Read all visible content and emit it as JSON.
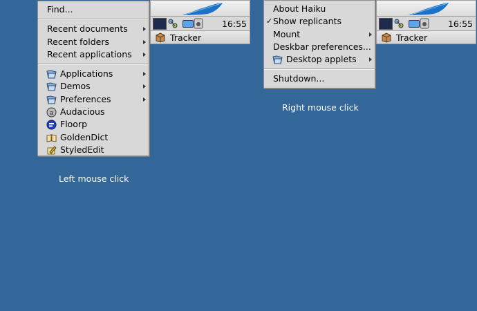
{
  "left_menu": {
    "items": [
      {
        "label": "Find...",
        "icon": "",
        "submenu": false
      },
      {
        "sep": true
      },
      {
        "label": "Recent documents",
        "icon": "",
        "submenu": true
      },
      {
        "label": "Recent folders",
        "icon": "",
        "submenu": true
      },
      {
        "label": "Recent applications",
        "icon": "",
        "submenu": true
      },
      {
        "sep": true
      },
      {
        "label": "Applications",
        "icon": "folder-icon",
        "submenu": true
      },
      {
        "label": "Demos",
        "icon": "folder-icon",
        "submenu": true
      },
      {
        "label": "Preferences",
        "icon": "folder-icon",
        "submenu": true
      },
      {
        "label": "Audacious",
        "icon": "audacious-icon",
        "submenu": false
      },
      {
        "label": "Floorp",
        "icon": "floorp-icon",
        "submenu": false
      },
      {
        "label": "GoldenDict",
        "icon": "book-icon",
        "submenu": false
      },
      {
        "label": "StyledEdit",
        "icon": "pencil-icon",
        "submenu": false
      }
    ]
  },
  "right_menu": {
    "items": [
      {
        "label": "About Haiku",
        "icon": "",
        "submenu": false,
        "checked": false
      },
      {
        "label": "Show replicants",
        "icon": "",
        "submenu": false,
        "checked": true
      },
      {
        "label": "Mount",
        "icon": "",
        "submenu": true,
        "checked": false
      },
      {
        "label": "Deskbar preferences...",
        "icon": "",
        "submenu": false,
        "checked": false
      },
      {
        "label": "Desktop applets",
        "icon": "folder-icon",
        "submenu": true,
        "checked": false
      },
      {
        "sep": true
      },
      {
        "label": "Shutdown...",
        "icon": "",
        "submenu": false,
        "checked": false
      }
    ]
  },
  "deskbar": {
    "clock": "16:55",
    "tracker_label": "Tracker",
    "leaf_color": "#1a73c8"
  },
  "captions": {
    "left": "Left mouse click",
    "right": "Right mouse click"
  },
  "colors": {
    "desktop": "#336699",
    "menu_bg": "#d8d8d8"
  }
}
